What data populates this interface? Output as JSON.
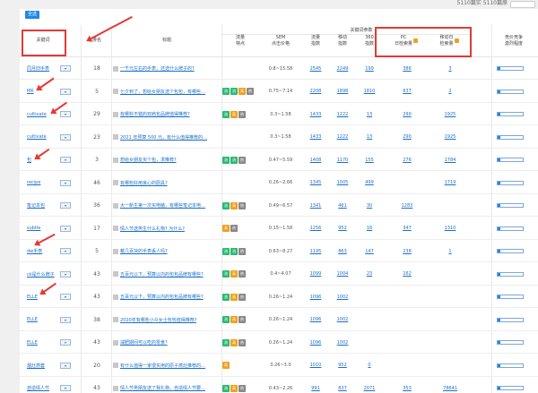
{
  "topbar": {
    "stats": "5110篇实   5110篇原"
  },
  "toolbar": {
    "button_label": "全选"
  },
  "headers": {
    "keyword": "关键词",
    "rank": "排名",
    "title": "标题",
    "features": "流量\n特点",
    "cpc": "SEM\n点击价格",
    "group": "关键词参数",
    "flow": "流量\n指数",
    "mobile": "移动\n指数",
    "s360": "360\n指数",
    "pc_daily": "PC\n日检索量",
    "mobile_daily": "移动日\n检索量",
    "competition": "竞价竞争\n激烈程度"
  },
  "rows": [
    {
      "kw": "同月旧手表",
      "rank": "18",
      "title": "一千元左右的手表，还选什么牌子的?",
      "tags": [],
      "cpc": "0.8~15.58",
      "flow": "2545",
      "mobile": "2249",
      "s360": "199",
      "pc": "386",
      "mob": "3",
      "bar": 0.1
    },
    {
      "kw": "MK",
      "rank": "5",
      "title": "七夕到了，想给女朋友送个包包，有哪些…",
      "tags": [
        "g",
        "g",
        "o",
        "r"
      ],
      "cpc": "0.75~7.14",
      "flow": "2208",
      "mobile": "1898",
      "s360": "1810",
      "pc": "637",
      "mob": "2",
      "bar": 0.1
    },
    {
      "kw": "cultivate",
      "rank": "29",
      "title": "有哪些不错的双肩包品牌值得推荐?",
      "tags": [
        "g",
        "o",
        "r"
      ],
      "cpc": "0.3~1.58",
      "flow": "1433",
      "mobile": "1222",
      "s360": "13",
      "pc": "290",
      "mob": "1925",
      "bar": 0.1
    },
    {
      "kw": "cultivate",
      "rank": "23",
      "title": "2021 年预算 500 元，有什么值得推荐的…",
      "tags": [],
      "cpc": "0.3~1.58",
      "flow": "1433",
      "mobile": "1222",
      "s360": "13",
      "pc": "290",
      "mob": "1925",
      "bar": 0.1
    },
    {
      "kw": "包",
      "rank": "3",
      "title": "想给女朋友买个包，求推荐?",
      "tags": [
        "g",
        "g",
        "r"
      ],
      "cpc": "0.47~5.59",
      "flow": "1408",
      "mobile": "1170",
      "s360": "155",
      "pc": "276",
      "mob": "1784",
      "bar": 0.1
    },
    {
      "kw": "recipe",
      "rank": "46",
      "title": "有哪些好用良心的厨具?",
      "tags": [],
      "cpc": "0.26~2.66",
      "flow": "1345",
      "mobile": "1005",
      "s360": "499",
      "pc": "",
      "mob": "1719",
      "bar": 0.1
    },
    {
      "kw": "笔记本包",
      "rank": "36",
      "title": "大一新生第一次买电脑，有哪些笔记本电…",
      "tags": [
        "g",
        "o",
        "r"
      ],
      "cpc": "0.49~6.57",
      "flow": "1341",
      "mobile": "461",
      "s360": "30",
      "pc": "1283",
      "mob": "",
      "bar": 0.1
    },
    {
      "kw": "subtle",
      "rank": "17",
      "title": "情人节送男生什么礼物? 为什么?",
      "tags": [
        "o",
        "r"
      ],
      "cpc": "0.15~1.58",
      "flow": "1256",
      "mobile": "952",
      "s360": "16",
      "pc": "347",
      "mob": "1310",
      "bar": 0.1
    },
    {
      "kw": "dw手表",
      "rank": "5",
      "title": "戴几百块的手表丢人吗?",
      "tags": [
        "g",
        "g",
        "r"
      ],
      "cpc": "0.63~8.27",
      "flow": "1195",
      "mobile": "863",
      "s360": "147",
      "pc": "238",
      "mob": "1",
      "bar": 0.1
    },
    {
      "kw": "ck是什么牌子",
      "rank": "43",
      "title": "五百元以下，预算以内的包包品牌有哪些?",
      "tags": [
        "g",
        "o",
        "r"
      ],
      "cpc": "0.4~4.07",
      "flow": "1099",
      "mobile": "1004",
      "s360": "23",
      "pc": "162",
      "mob": "",
      "bar": 0.1
    },
    {
      "kw": "ELLE",
      "rank": "43",
      "title": "五百元以下，预算以内的包包品牌有哪些?",
      "tags": [
        "g",
        "o",
        "r"
      ],
      "cpc": "0.26~1.24",
      "flow": "1096",
      "mobile": "1002",
      "s360": "",
      "pc": "",
      "mob": "",
      "bar": 0.1
    },
    {
      "kw": "ELLE",
      "rank": "38",
      "title": "2020年有哪些小众女士包包值得推荐?",
      "tags": [
        "g",
        "o",
        "r"
      ],
      "cpc": "0.26~1.24",
      "flow": "1096",
      "mobile": "1002",
      "s360": "",
      "pc": "",
      "mob": "",
      "bar": 0.1
    },
    {
      "kw": "ELLE",
      "rank": "43",
      "title": "减肥期间可以吃的零食?",
      "tags": [
        "g",
        "o",
        "r"
      ],
      "cpc": "0.26~1.24",
      "flow": "1096",
      "mobile": "1002",
      "s360": "",
      "pc": "",
      "mob": "",
      "bar": 0.1
    },
    {
      "kw": "烟灶燃套",
      "rank": "20",
      "title": "有什么值得一家很实用的原子燃灶推荐的…",
      "tags": [
        "o"
      ],
      "cpc": "0.26~3.0",
      "flow": "1010",
      "mobile": "952",
      "s360": "0",
      "pc": "",
      "mob": "",
      "bar": 0.1
    },
    {
      "kw": "自造情人节",
      "rank": "43",
      "title": "情人节男朋友送了我礼物，自造情人节要…",
      "tags": [
        "g",
        "o",
        "r"
      ],
      "cpc": "0.43~2.26",
      "flow": "991",
      "mobile": "837",
      "s360": "2071",
      "pc": "353",
      "mob": "78641",
      "bar": 0.1
    }
  ]
}
